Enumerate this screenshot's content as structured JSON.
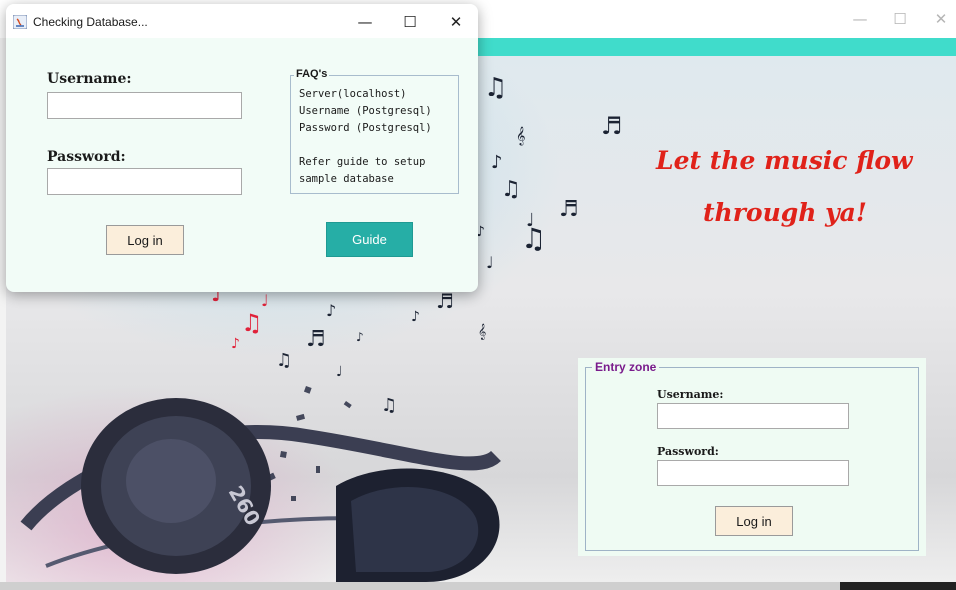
{
  "dialog": {
    "title": "Checking Database...",
    "controls": {
      "minimize": "—",
      "maximize": "☐",
      "close": "✕"
    },
    "username_label": "Username:",
    "password_label": "Password:",
    "username_value": "",
    "password_value": "",
    "faq": {
      "legend": "FAQ's",
      "lines": [
        "Server(localhost)",
        "Username (Postgresql)",
        "Password (Postgresql)",
        "",
        "Refer guide to setup",
        "sample database"
      ]
    },
    "login_label": "Log in",
    "guide_label": "Guide"
  },
  "main_window": {
    "controls": {
      "minimize": "—",
      "maximize": "☐",
      "close": "✕"
    },
    "tagline": [
      "Let the music flow",
      "through ya!"
    ],
    "entry_zone": {
      "legend": "Entry zone",
      "username_label": "Username:",
      "password_label": "Password:",
      "username_value": "",
      "password_value": "",
      "login_label": "Log in"
    },
    "headphones_brand": "260"
  },
  "colors": {
    "accent_bar": "#40dccb",
    "guide_button": "#26aea6",
    "login_button": "#fbeedb",
    "tagline": "#e0221a",
    "entry_legend": "#7a1c8c"
  }
}
